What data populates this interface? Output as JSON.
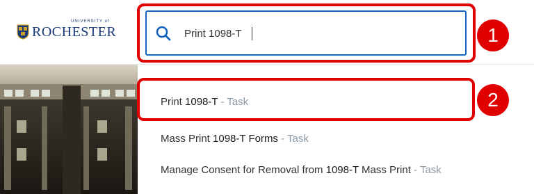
{
  "header": {
    "logo": {
      "small_text": "UNIVERSITY of",
      "big_text": "ROCHESTER"
    }
  },
  "search": {
    "value": "Print 1098-T"
  },
  "results": [
    {
      "parts": [
        "Print ",
        "1098-T"
      ],
      "type": " - Task"
    },
    {
      "parts": [
        "Mass Print ",
        "1098-T Forms"
      ],
      "type": " - Task"
    },
    {
      "parts": [
        "Manage Consent for Removal from ",
        "1098-T",
        " Mass Print"
      ],
      "type": " - Task"
    }
  ],
  "callouts": {
    "badge_1": "1",
    "badge_2": "2"
  },
  "colors": {
    "highlight": "#e10000",
    "search_border": "#1565c0",
    "task_type": "#8a9aa6",
    "brand": "#1a3b78"
  }
}
